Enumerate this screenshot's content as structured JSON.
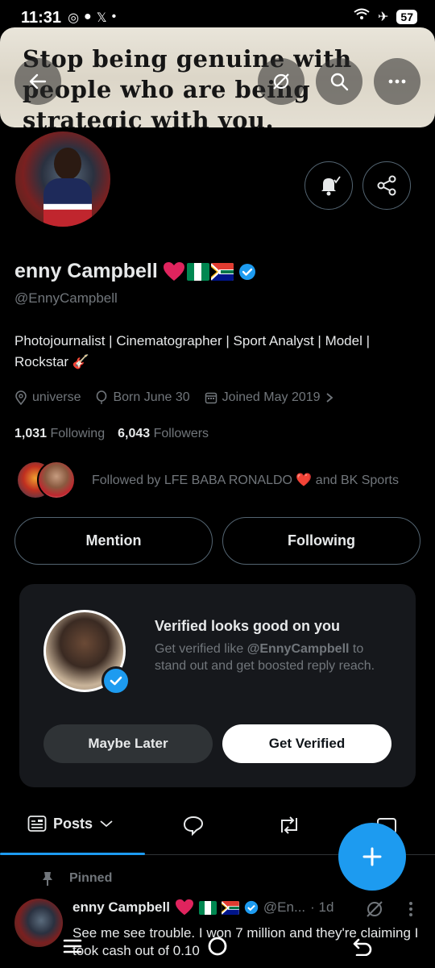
{
  "status_bar": {
    "time": "11:31",
    "battery": "57"
  },
  "banner": {
    "text": "Stop being genuine with people who are being strategic with you."
  },
  "profile": {
    "display_name": "enny Campbell",
    "handle": "@EnnyCampbell",
    "bio": "Photojournalist | Cinematographer | Sport Analyst | Model | Rockstar 🎸",
    "location": "universe",
    "birthday": "Born June 30",
    "joined": "Joined May 2019",
    "following_count": "1,031",
    "following_label": "Following",
    "followers_count": "6,043",
    "followers_label": "Followers",
    "followed_by": "Followed by LFE BABA RONALDO ❤️ and BK Sports"
  },
  "actions": {
    "mention": "Mention",
    "following": "Following"
  },
  "verify_card": {
    "title": "Verified looks good on you",
    "desc_prefix": "Get verified like ",
    "desc_handle": "@EnnyCampbell",
    "desc_suffix": " to stand out and get boosted reply reach.",
    "maybe_later": "Maybe Later",
    "get_verified": "Get Verified"
  },
  "tabs": {
    "posts": "Posts"
  },
  "pinned": {
    "label": "Pinned",
    "author": "enny Campbell",
    "handle": "@En...",
    "time": "· 1d",
    "text": "See me see trouble. I won 7 million and they're claiming I took cash out of 0.10"
  },
  "colors": {
    "accent": "#1d9bf0",
    "heart": "#f91880",
    "muted": "#71767b"
  },
  "icons": [
    "back-arrow-icon",
    "grok-icon",
    "search-icon",
    "more-icon",
    "bell-icon",
    "share-icon",
    "location-icon",
    "balloon-icon",
    "calendar-icon",
    "compose-icon",
    "pin-icon"
  ]
}
